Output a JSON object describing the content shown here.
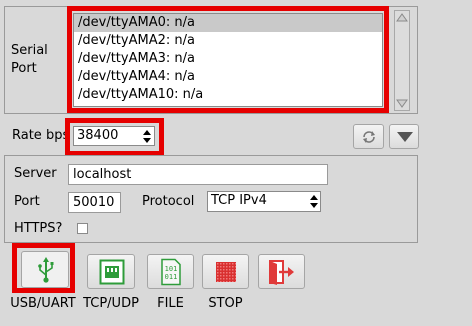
{
  "serial": {
    "label": "Serial\nPort",
    "ports": [
      "/dev/ttyAMA0: n/a",
      "/dev/ttyAMA2: n/a",
      "/dev/ttyAMA3: n/a",
      "/dev/ttyAMA4: n/a",
      "/dev/ttyAMA10: n/a"
    ],
    "selected_index": 0
  },
  "rate": {
    "label": "Rate bps",
    "value": "38400"
  },
  "network": {
    "server_label": "Server",
    "server_value": "localhost",
    "port_label": "Port",
    "port_value": "50010",
    "protocol_label": "Protocol",
    "protocol_value": "TCP IPv4",
    "https_label": "HTTPS?",
    "https_checked": false
  },
  "toolbar": {
    "usb_label": "USB/UART",
    "tcp_label": "TCP/UDP",
    "file_label": "FILE",
    "stop_label": "STOP"
  },
  "colors": {
    "highlight_red": "#e60000",
    "usb_icon_green": "#2e9c3a",
    "stop_icon_red": "#d93030",
    "exit_icon_red": "#e03a3a"
  }
}
